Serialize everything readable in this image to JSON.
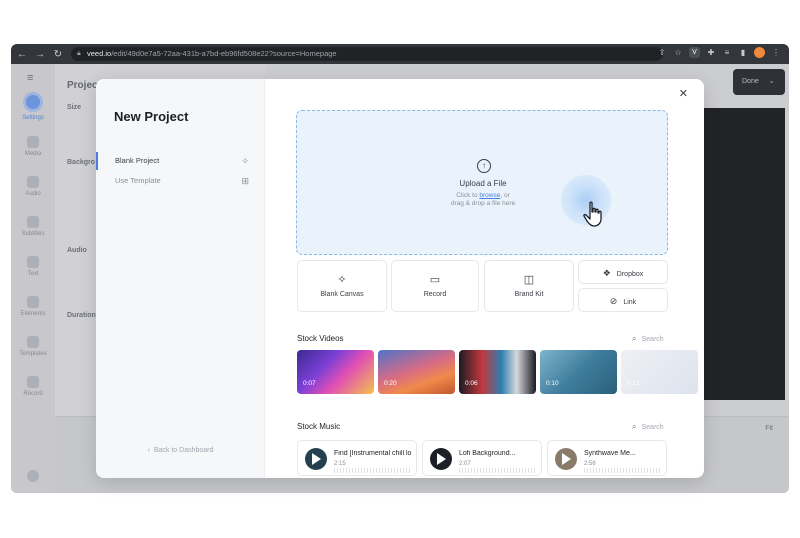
{
  "browser": {
    "url_domain": "veed.io",
    "url_path": "/edit/49d0e7a5-72aa-431b-a7bd-eb96fd508e22?source=Homepage",
    "profile_badge": "V"
  },
  "app": {
    "sidebar": [
      {
        "label": "Settings"
      },
      {
        "label": "Media"
      },
      {
        "label": "Audio"
      },
      {
        "label": "Subtitles"
      },
      {
        "label": "Text"
      },
      {
        "label": "Elements"
      },
      {
        "label": "Templates"
      },
      {
        "label": "Record"
      }
    ],
    "panel": {
      "title": "Project",
      "size_label": "Size",
      "background_label": "Backgro",
      "audio_label": "Audio",
      "duration_label": "Duration"
    },
    "done_label": "Done",
    "fit_label": "Fit"
  },
  "modal": {
    "title": "New Project",
    "menu": [
      {
        "label": "Blank Project",
        "icon": "sparkle-icon"
      },
      {
        "label": "Use Template",
        "icon": "template-icon"
      }
    ],
    "back_label": "Back to Dashboard",
    "upload": {
      "title": "Upload a File",
      "line1_pre": "Click to ",
      "line1_link": "browse",
      "line1_post": ", or",
      "line2": "drag & drop a file here"
    },
    "options": [
      {
        "label": "Blank Canvas",
        "icon": "sparkle-icon"
      },
      {
        "label": "Record",
        "icon": "camera-icon"
      },
      {
        "label": "Brand Kit",
        "icon": "brand-kit-icon"
      }
    ],
    "side_options": [
      {
        "label": "Dropbox",
        "icon": "dropbox-icon"
      },
      {
        "label": "Link",
        "icon": "link-icon"
      }
    ],
    "stock_videos": {
      "title": "Stock Videos",
      "search_placeholder": "Search",
      "items": [
        {
          "duration": "0:07"
        },
        {
          "duration": "0:20"
        },
        {
          "duration": "0:06"
        },
        {
          "duration": "0:10"
        },
        {
          "duration": "0:12"
        }
      ]
    },
    "stock_music": {
      "title": "Stock Music",
      "search_placeholder": "Search",
      "items": [
        {
          "title": "Find [Instrumental chill lo",
          "duration": "2:15"
        },
        {
          "title": "Lofi Background...",
          "duration": "2:07"
        },
        {
          "title": "Synthwave Me...",
          "duration": "2:56"
        }
      ]
    }
  },
  "colors": {
    "accent": "#4a7fe0",
    "upload_bg": "#eaf3fc",
    "dark": "#1e2128"
  }
}
